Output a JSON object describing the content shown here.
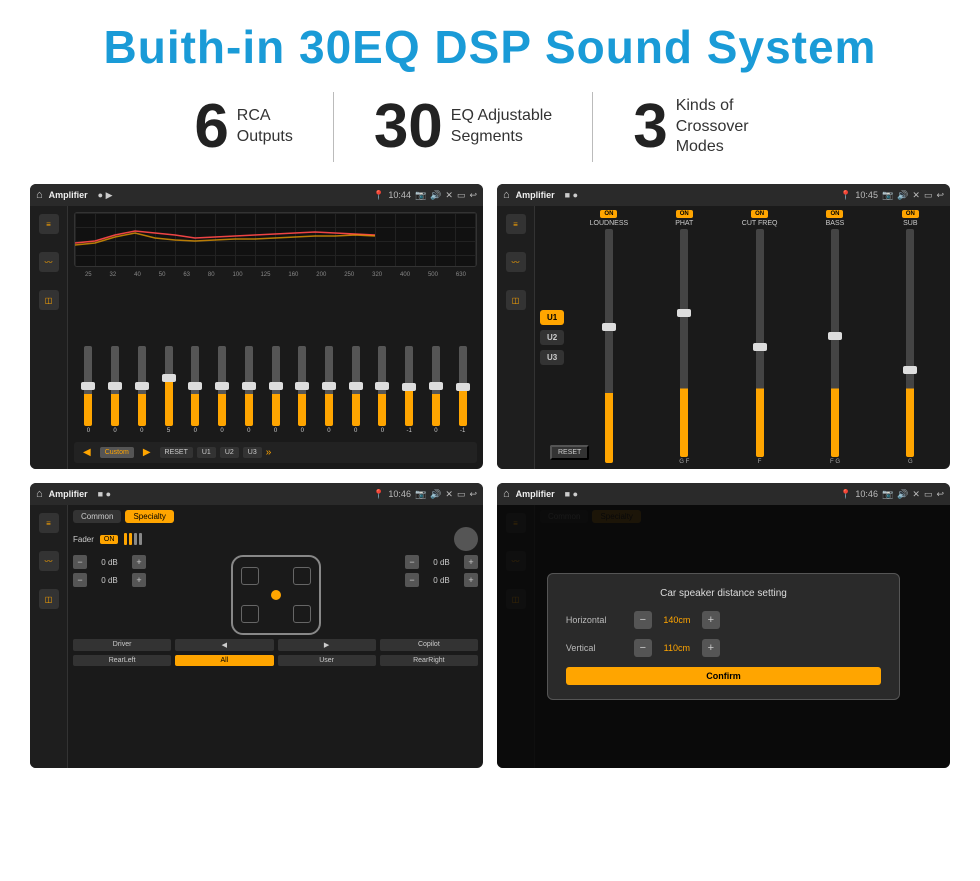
{
  "header": {
    "title": "Buith-in 30EQ DSP Sound System"
  },
  "stats": [
    {
      "number": "6",
      "label_line1": "RCA",
      "label_line2": "Outputs"
    },
    {
      "number": "30",
      "label_line1": "EQ Adjustable",
      "label_line2": "Segments"
    },
    {
      "number": "3",
      "label_line1": "Kinds of",
      "label_line2": "Crossover Modes"
    }
  ],
  "screens": [
    {
      "id": "eq-screen",
      "topbar": {
        "title": "Amplifier",
        "time": "10:44",
        "dots": "play"
      },
      "eq_labels": [
        "25",
        "32",
        "40",
        "50",
        "63",
        "80",
        "100",
        "125",
        "160",
        "200",
        "250",
        "320",
        "400",
        "500",
        "630"
      ],
      "eq_values": [
        "0",
        "0",
        "0",
        "5",
        "0",
        "0",
        "0",
        "0",
        "0",
        "0",
        "0",
        "0",
        "-1",
        "0",
        "-1"
      ],
      "bottom_btns": [
        "Custom",
        "RESET",
        "U1",
        "U2",
        "U3"
      ]
    },
    {
      "id": "amp-screen",
      "topbar": {
        "title": "Amplifier",
        "time": "10:45",
        "dots": "record"
      },
      "u_buttons": [
        "U1",
        "U2",
        "U3"
      ],
      "channels": [
        "LOUDNESS",
        "PHAT",
        "CUT FREQ",
        "BASS",
        "SUB"
      ],
      "reset_label": "RESET"
    },
    {
      "id": "speaker-screen",
      "topbar": {
        "title": "Amplifier",
        "time": "10:46",
        "dots": "record"
      },
      "tabs": [
        "Common",
        "Specialty"
      ],
      "fader_label": "Fader",
      "fader_on": "ON",
      "db_values": [
        "0 dB",
        "0 dB",
        "0 dB",
        "0 dB"
      ],
      "footer_btns": [
        "Driver",
        "",
        "",
        "",
        "Copilot",
        "RearLeft",
        "All",
        "User",
        "RearRight"
      ]
    },
    {
      "id": "dialog-screen",
      "topbar": {
        "title": "Amplifier",
        "time": "10:46",
        "dots": "record"
      },
      "dialog": {
        "title": "Car speaker distance setting",
        "horizontal_label": "Horizontal",
        "horizontal_value": "140cm",
        "vertical_label": "Vertical",
        "vertical_value": "110cm",
        "confirm_label": "Confirm"
      }
    }
  ]
}
